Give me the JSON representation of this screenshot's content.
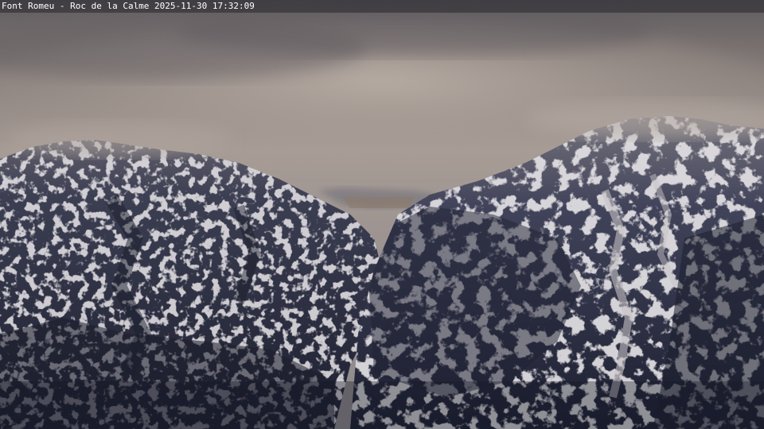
{
  "overlay": {
    "location": "Font Romeu",
    "separator": " - ",
    "camera": "Roc de la Calme",
    "date": "2025-11-30",
    "time": "17:32:09",
    "text": "Font Romeu - Roc de la Calme 2025-11-30 17:32:09"
  },
  "scene": {
    "subject": "snow-dusted mountain peaks under low cloud",
    "colors": {
      "sky_top": "#6e6a6c",
      "sky_mid": "#a49a94",
      "cloud_light": "#b8aca4",
      "mountain_dark": "#22253a",
      "snow": "#c9c4c6"
    }
  }
}
